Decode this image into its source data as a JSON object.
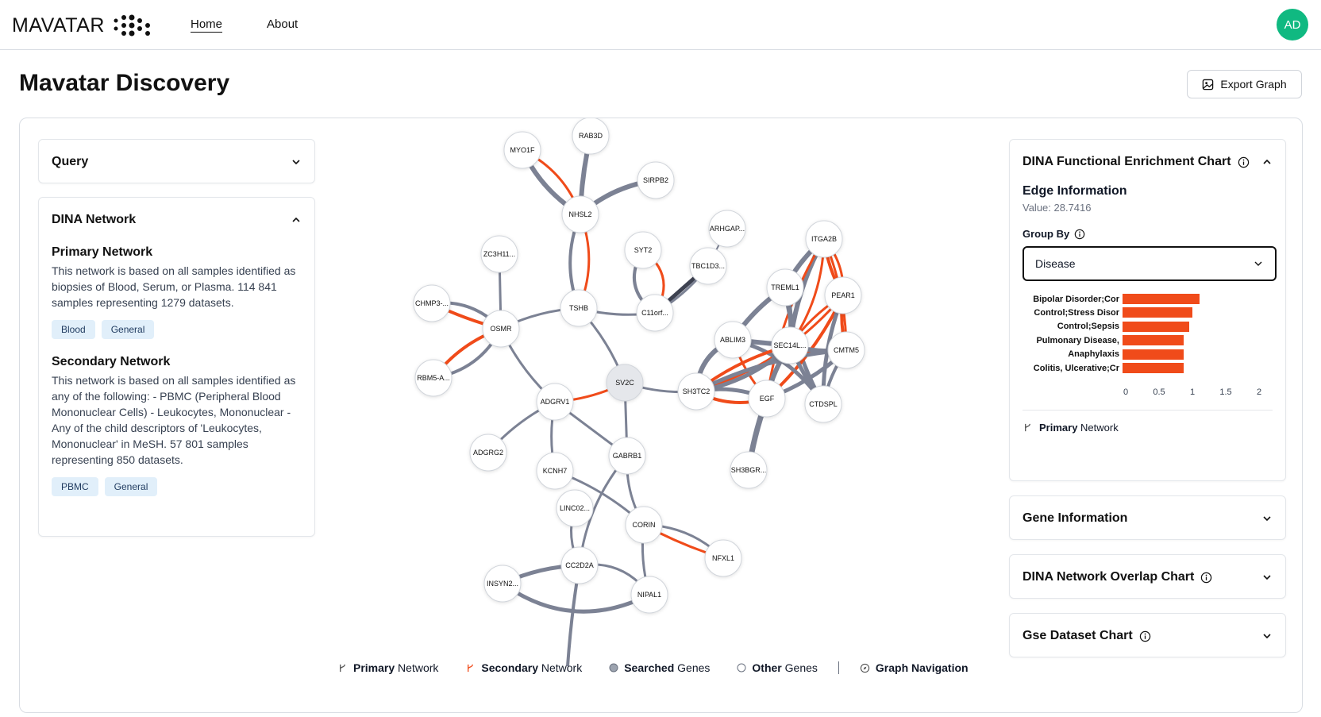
{
  "app": {
    "logo_text": "MAVATAR",
    "nav": {
      "home": "Home",
      "about": "About"
    },
    "avatar": "AD"
  },
  "page": {
    "title": "Mavatar Discovery",
    "export_label": "Export Graph"
  },
  "left": {
    "query_title": "Query",
    "dina_title": "DINA Network",
    "primary": {
      "title": "Primary Network",
      "description": "This network is based on all samples identified as biopsies of Blood, Serum, or Plasma. 114 841 samples representing 1279 datasets.",
      "tags": [
        "Blood",
        "General"
      ]
    },
    "secondary": {
      "title": "Secondary Network",
      "description": "This network is based on all samples identified as any of the following: - PBMC (Peripheral Blood Mononuclear Cells) - Leukocytes, Mononuclear - Any of the child descriptors of 'Leukocytes, Mononuclear' in MeSH. 57 801 samples representing 850 datasets.",
      "tags": [
        "PBMC",
        "General"
      ]
    }
  },
  "right": {
    "enrichment": {
      "title": "DINA Functional Enrichment Chart",
      "edge_title": "Edge Information",
      "edge_value": "Value: 28.7416",
      "group_by_label": "Group By",
      "group_by_value": "Disease",
      "network_label_bold": "Primary",
      "network_label_rest": " Network"
    },
    "gene_info_title": "Gene Information",
    "overlap_title": "DINA Network Overlap Chart",
    "gse_title": "Gse Dataset Chart"
  },
  "chart_data": {
    "type": "bar",
    "orientation": "horizontal",
    "categories": [
      "Bipolar Disorder;Cor",
      "Control;Stress Disor",
      "Control;Sepsis",
      "Pulmonary Disease,",
      "Anaphylaxis",
      "Colitis, Ulcerative;Cr"
    ],
    "values": [
      1.15,
      1.05,
      1.0,
      0.92,
      0.92,
      0.92
    ],
    "xlim": [
      0,
      2
    ],
    "xticks": [
      "0",
      "0.5",
      "1",
      "1.5",
      "2"
    ],
    "bar_color": "#f04b1a"
  },
  "graph": {
    "colors": {
      "primary": "#7c8294",
      "secondary": "#f04b1a",
      "dark": "#3d4150"
    },
    "nodes": [
      {
        "id": "MYO1F",
        "label": "MYO1F"
      },
      {
        "id": "RAB3D",
        "label": "RAB3D"
      },
      {
        "id": "SIRPB2",
        "label": "SIRPB2"
      },
      {
        "id": "NHSL2",
        "label": "NHSL2"
      },
      {
        "id": "ARHGAP",
        "label": "ARHGAP..."
      },
      {
        "id": "ITGA2B",
        "label": "ITGA2B"
      },
      {
        "id": "ZC3H11",
        "label": "ZC3H11..."
      },
      {
        "id": "SYT2",
        "label": "SYT2"
      },
      {
        "id": "TBC1D3",
        "label": "TBC1D3..."
      },
      {
        "id": "TREML1",
        "label": "TREML1"
      },
      {
        "id": "PEAR1",
        "label": "PEAR1"
      },
      {
        "id": "CHMP3",
        "label": "CHMP3-..."
      },
      {
        "id": "TSHB",
        "label": "TSHB"
      },
      {
        "id": "C11orf",
        "label": "C11orf..."
      },
      {
        "id": "OSMR",
        "label": "OSMR"
      },
      {
        "id": "ABLIM3",
        "label": "ABLIM3"
      },
      {
        "id": "SEC14L",
        "label": "SEC14L..."
      },
      {
        "id": "CMTM5",
        "label": "CMTM5"
      },
      {
        "id": "RBM5A",
        "label": "RBM5-A..."
      },
      {
        "id": "SV2C",
        "label": "SV2C"
      },
      {
        "id": "SH3TC2",
        "label": "SH3TC2"
      },
      {
        "id": "EGF",
        "label": "EGF"
      },
      {
        "id": "CTDSPL",
        "label": "CTDSPL"
      },
      {
        "id": "ADGRV1",
        "label": "ADGRV1"
      },
      {
        "id": "ADGRG2",
        "label": "ADGRG2"
      },
      {
        "id": "GABRB1",
        "label": "GABRB1"
      },
      {
        "id": "KCNH7",
        "label": "KCNH7"
      },
      {
        "id": "SH3BGR",
        "label": "SH3BGR..."
      },
      {
        "id": "LINC02",
        "label": "LINC02..."
      },
      {
        "id": "CORIN",
        "label": "CORIN"
      },
      {
        "id": "NFXL1",
        "label": "NFXL1"
      },
      {
        "id": "CC2D2A",
        "label": "CC2D2A"
      },
      {
        "id": "INSYN2",
        "label": "INSYN2..."
      },
      {
        "id": "NIPAL1",
        "label": "NIPAL1"
      }
    ],
    "searched": [
      "SV2C"
    ],
    "legend": {
      "primary_bold": "Primary",
      "primary_rest": " Network",
      "secondary_bold": "Secondary",
      "secondary_rest": " Network",
      "searched_bold": "Searched",
      "searched_rest": " Genes",
      "other_bold": "Other",
      "other_rest": " Genes",
      "nav_label": "Graph Navigation"
    }
  }
}
